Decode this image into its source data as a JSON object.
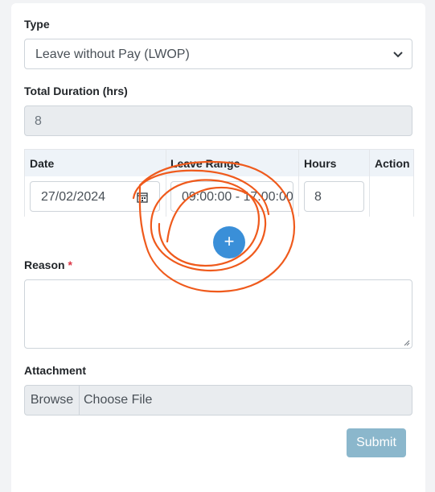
{
  "form": {
    "type_label": "Type",
    "type_value": "Leave without Pay (LWOP)",
    "duration_label": "Total Duration (hrs)",
    "duration_value": "8",
    "table": {
      "headers": [
        "Date",
        "Leave Range",
        "Hours",
        "Action"
      ],
      "rows": [
        {
          "date": "27/02/2024",
          "range": "09:00:00 - 17:00:00",
          "hours": "8"
        }
      ]
    },
    "add_row_symbol": "+",
    "reason_label": "Reason",
    "required_mark": "*",
    "reason_value": "",
    "attachment_label": "Attachment",
    "browse_label": "Browse",
    "file_placeholder": "Choose File",
    "submit_label": "Submit"
  },
  "colors": {
    "add_button": "#3a8fd8",
    "submit_button": "#8bb7cc",
    "annotation": "#ef5a1c",
    "required": "#dc3545"
  },
  "icons": [
    "chevron-down-icon",
    "calendar-icon",
    "plus-icon",
    "resize-grip-icon"
  ]
}
